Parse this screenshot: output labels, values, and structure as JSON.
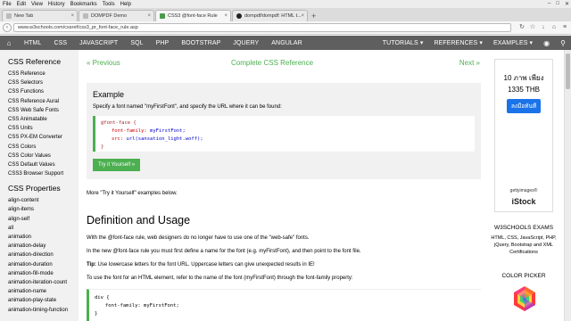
{
  "menubar": [
    "File",
    "Edit",
    "View",
    "History",
    "Bookmarks",
    "Tools",
    "Help"
  ],
  "tabs": [
    {
      "label": "New Tab",
      "active": false
    },
    {
      "label": "DOMPDF Demo",
      "active": false
    },
    {
      "label": "CSS3 @font-face Rule",
      "active": true
    },
    {
      "label": "dompdf/dompdf: HTML t...",
      "active": false
    }
  ],
  "address": {
    "url": "www.w3schools.com/cssref/css3_pr_font-face_rule.asp"
  },
  "w3nav": {
    "items": [
      "HTML",
      "CSS",
      "JAVASCRIPT",
      "SQL",
      "PHP",
      "BOOTSTRAP",
      "JQUERY",
      "ANGULAR"
    ],
    "right": [
      "TUTORIALS ▾",
      "REFERENCES ▾",
      "EXAMPLES ▾"
    ]
  },
  "sidebar": {
    "ref_title": "CSS Reference",
    "ref_links": [
      "CSS Reference",
      "CSS Selectors",
      "CSS Functions",
      "CSS Reference Aural",
      "CSS Web Safe Fonts",
      "CSS Animatable",
      "CSS Units",
      "CSS PX-EM Converter",
      "CSS Colors",
      "CSS Color Values",
      "CSS Default Values",
      "CSS3 Browser Support"
    ],
    "props_title": "CSS Properties",
    "props_links": [
      "align-content",
      "align-items",
      "align-self",
      "all",
      "animation",
      "animation-delay",
      "animation-direction",
      "animation-duration",
      "animation-fill-mode",
      "animation-iteration-count",
      "animation-name",
      "animation-play-state",
      "animation-timing-function"
    ]
  },
  "main": {
    "prev": "« Previous",
    "mid": "Complete CSS Reference",
    "next": "Next »",
    "example_title": "Example",
    "example_desc": "Specify a font named \"myFirstFont\", and specify the URL where it can be found:",
    "code": {
      "line1": "@font-face {",
      "l2_prop": "font-family:",
      "l2_val": " myFirstFont;",
      "l3_prop": "src:",
      "l3_val": " url(sansation_light.woff);",
      "line4": "}"
    },
    "try_button": "Try it Yourself »",
    "more": "More \"Try it Yourself\" examples below.",
    "heading": "Definition and Usage",
    "p1": "With the @font-face rule, web designers do no longer have to use one of the \"web-safe\" fonts.",
    "p2": "In the new @font-face rule you must first define a name for the font (e.g. myFirstFont), and then point to the font file.",
    "tip_label": "Tip:",
    "tip_text": " Use lowercase letters for the font URL. Uppercase letters can give unexpected results in IE!",
    "p3": "To use the font for an HTML element, refer to the name of the font (myFirstFont) through the font-family property:",
    "code2": {
      "line1": "div {",
      "line2": "font-family: myFirstFont;",
      "line3": "}"
    }
  },
  "ad": {
    "line1": "10 ภาพ เพียง",
    "line2": "1335 THB",
    "button": "ลงมือทันที",
    "getty": "gettyimages®",
    "istock": "iStock"
  },
  "exams": {
    "title": "W3SCHOOLS EXAMS",
    "body": "HTML, CSS, JavaScript, PHP, jQuery, Bootstrap and XML Certifications"
  },
  "color_picker": "COLOR PICKER",
  "colors": {
    "green": "#4caf50",
    "nav": "#5f5f5f",
    "sidebar": "#f1f1f1"
  }
}
